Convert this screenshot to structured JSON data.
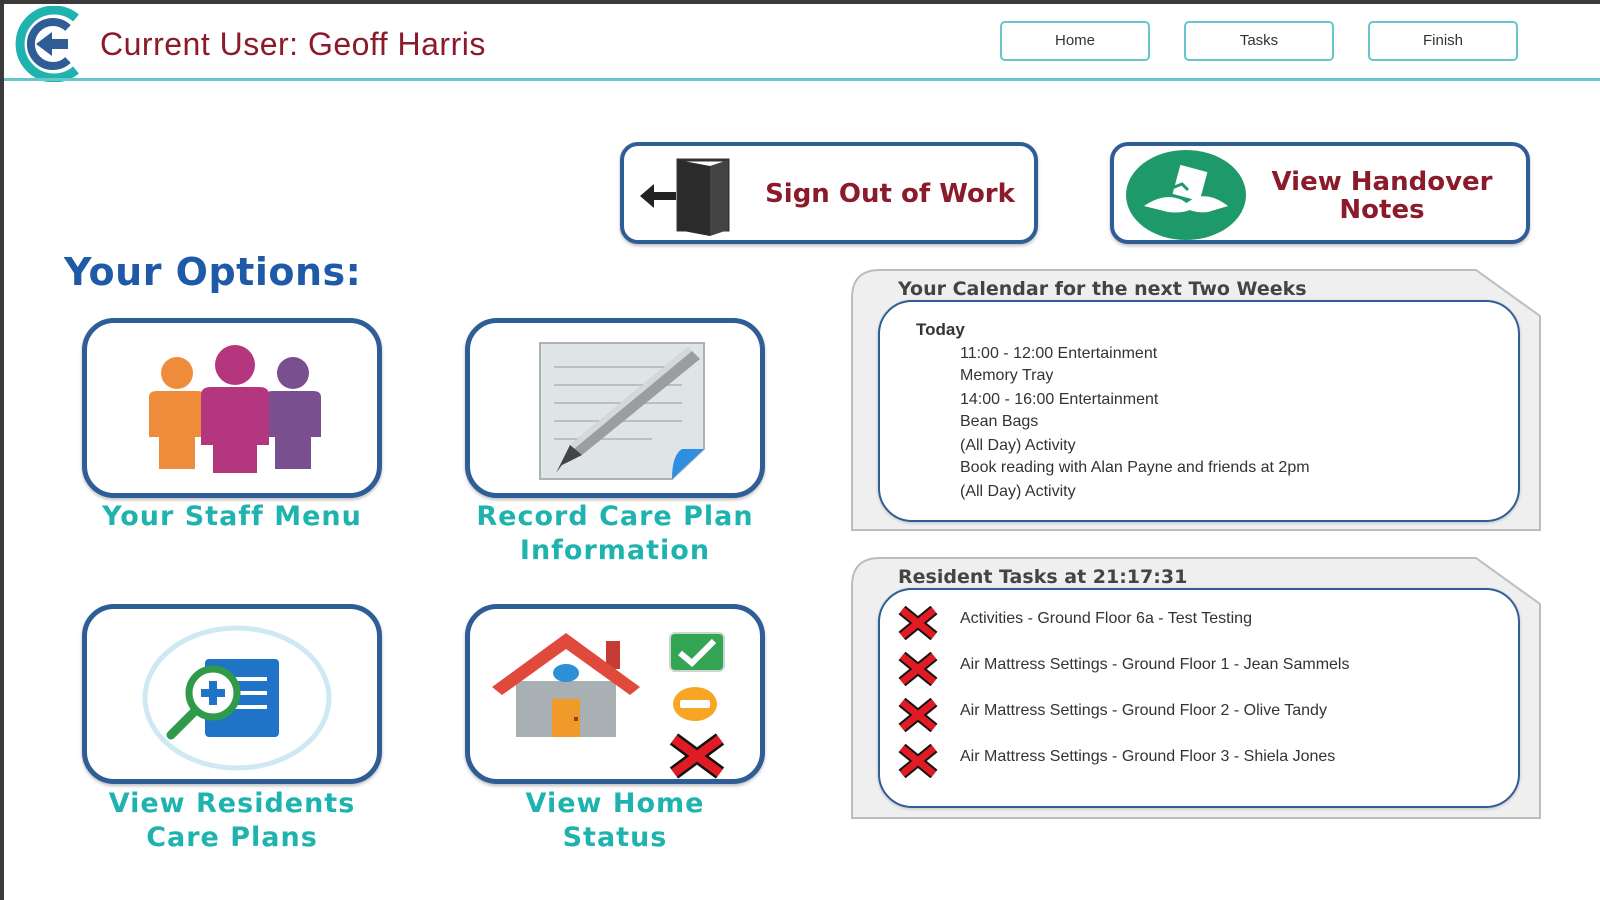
{
  "header": {
    "user_label": "Current User: Geoff Harris",
    "nav": [
      {
        "label": "Home"
      },
      {
        "label": "Tasks"
      },
      {
        "label": "Finish"
      }
    ]
  },
  "actions": {
    "sign_out": "Sign Out of Work",
    "handover_line1": "View Handover",
    "handover_line2": "Notes"
  },
  "options": {
    "title": "Your Options:",
    "staff_menu": {
      "line1": "Your Staff Menu"
    },
    "record_care": {
      "line1": "Record Care Plan",
      "line2": "Information"
    },
    "view_residents": {
      "line1": "View Residents",
      "line2": "Care Plans"
    },
    "home_status": {
      "line1": "View Home",
      "line2": "Status"
    }
  },
  "calendar": {
    "title": "Your Calendar for the next Two Weeks",
    "day": "Today",
    "entries": [
      "11:00 - 12:00 Entertainment",
      "Memory Tray",
      "14:00 - 16:00 Entertainment",
      "Bean Bags",
      "(All Day) Activity",
      "Book reading with Alan Payne and friends  at 2pm",
      "(All Day) Activity"
    ]
  },
  "tasks": {
    "title": "Resident Tasks at 21:17:31",
    "items": [
      {
        "text": "Activities - Ground Floor 6a - Test Testing",
        "status_icon": "red-x-icon"
      },
      {
        "text": "Air Mattress Settings - Ground Floor 1 - Jean Sammels",
        "status_icon": "red-x-icon"
      },
      {
        "text": "Air Mattress Settings - Ground Floor 2 - Olive Tandy",
        "status_icon": "red-x-icon"
      },
      {
        "text": "Air Mattress Settings - Ground Floor 3 - Shiela Jones",
        "status_icon": "red-x-icon"
      }
    ]
  },
  "colors": {
    "brand_red": "#8b1a2b",
    "brand_teal": "#1fb3b0",
    "tile_border": "#2f5d96",
    "title_blue": "#1e5aa8"
  }
}
